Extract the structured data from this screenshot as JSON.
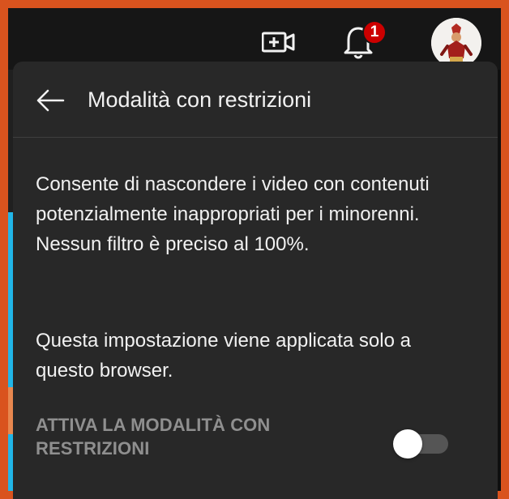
{
  "topbar": {
    "create_icon": "video-camera-plus-icon",
    "notifications_icon": "bell-icon",
    "notification_count": "1",
    "avatar": "avatar"
  },
  "panel": {
    "back_icon": "arrow-left-icon",
    "title": "Modalità con restrizioni",
    "description_1": "Consente di nascondere i video con contenuti potenzialmente inappropriati per i minorenni. Nessun filtro è preciso al 100%.",
    "description_2": "Questa impostazione viene applicata solo a questo browser.",
    "toggle_label": "ATTIVA LA MODALITÀ CON RESTRIZIONI",
    "toggle_state": "off"
  },
  "colors": {
    "outer_background": "#d9531e",
    "panel_background": "#282828",
    "badge": "#cc0000",
    "text": "#f1f1f1",
    "secondary_text": "#8f8f8f"
  }
}
